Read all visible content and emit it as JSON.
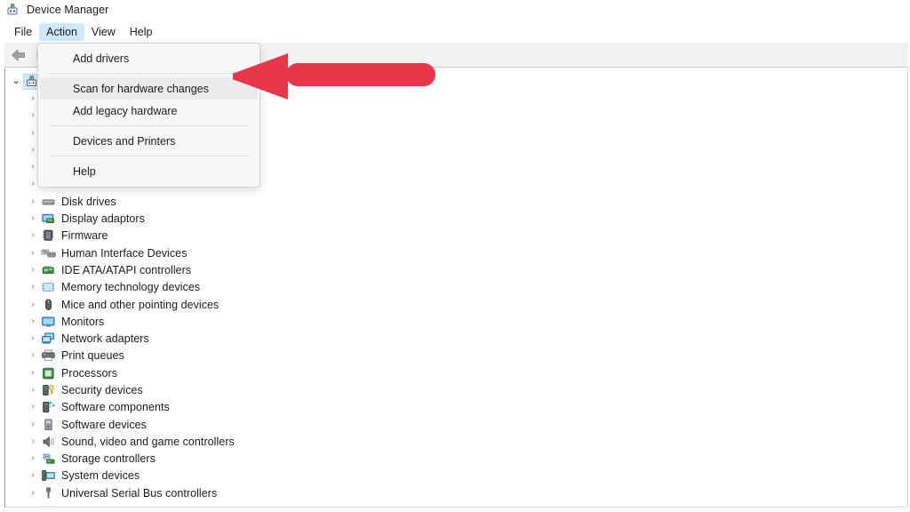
{
  "window": {
    "title": "Device Manager",
    "title_icon": "device-manager-icon"
  },
  "menubar": {
    "items": [
      {
        "label": "File",
        "active": false
      },
      {
        "label": "Action",
        "active": true
      },
      {
        "label": "View",
        "active": false
      },
      {
        "label": "Help",
        "active": false
      }
    ]
  },
  "toolbar": {
    "buttons": [
      {
        "icon": "back-arrow-icon"
      },
      {
        "icon": "forward-panel-icon"
      }
    ]
  },
  "action_menu": {
    "items": [
      {
        "label": "Add drivers",
        "highlighted": false,
        "separator_after": true
      },
      {
        "label": "Scan for hardware changes",
        "highlighted": true,
        "separator_after": false
      },
      {
        "label": "Add legacy hardware",
        "highlighted": false,
        "separator_after": true
      },
      {
        "label": "Devices and Printers",
        "highlighted": false,
        "separator_after": true
      },
      {
        "label": "Help",
        "highlighted": false,
        "separator_after": false
      }
    ]
  },
  "annotation": {
    "type": "left-arrow",
    "color": "#e8374a",
    "points_at": "Scan for hardware changes"
  },
  "tree": {
    "root": {
      "label": "",
      "expanded": true,
      "icon": "computer-icon",
      "selected": true
    },
    "hidden_count": 6,
    "items": [
      {
        "label": "Disk drives",
        "icon": "disk-drive-icon"
      },
      {
        "label": "Display adaptors",
        "icon": "display-adapter-icon"
      },
      {
        "label": "Firmware",
        "icon": "firmware-icon"
      },
      {
        "label": "Human Interface Devices",
        "icon": "hid-icon"
      },
      {
        "label": "IDE ATA/ATAPI controllers",
        "icon": "ide-controller-icon"
      },
      {
        "label": "Memory technology devices",
        "icon": "memory-icon"
      },
      {
        "label": "Mice and other pointing devices",
        "icon": "mouse-icon"
      },
      {
        "label": "Monitors",
        "icon": "monitor-icon"
      },
      {
        "label": "Network adapters",
        "icon": "network-adapter-icon"
      },
      {
        "label": "Print queues",
        "icon": "printer-icon"
      },
      {
        "label": "Processors",
        "icon": "processor-icon"
      },
      {
        "label": "Security devices",
        "icon": "security-device-icon"
      },
      {
        "label": "Software components",
        "icon": "software-component-icon"
      },
      {
        "label": "Software devices",
        "icon": "software-device-icon"
      },
      {
        "label": "Sound, video and game controllers",
        "icon": "speaker-icon"
      },
      {
        "label": "Storage controllers",
        "icon": "storage-controller-icon"
      },
      {
        "label": "System devices",
        "icon": "system-device-icon"
      },
      {
        "label": "Universal Serial Bus controllers",
        "icon": "usb-icon"
      }
    ],
    "chevron_collapsed": "›",
    "chevron_expanded": "⌄"
  }
}
